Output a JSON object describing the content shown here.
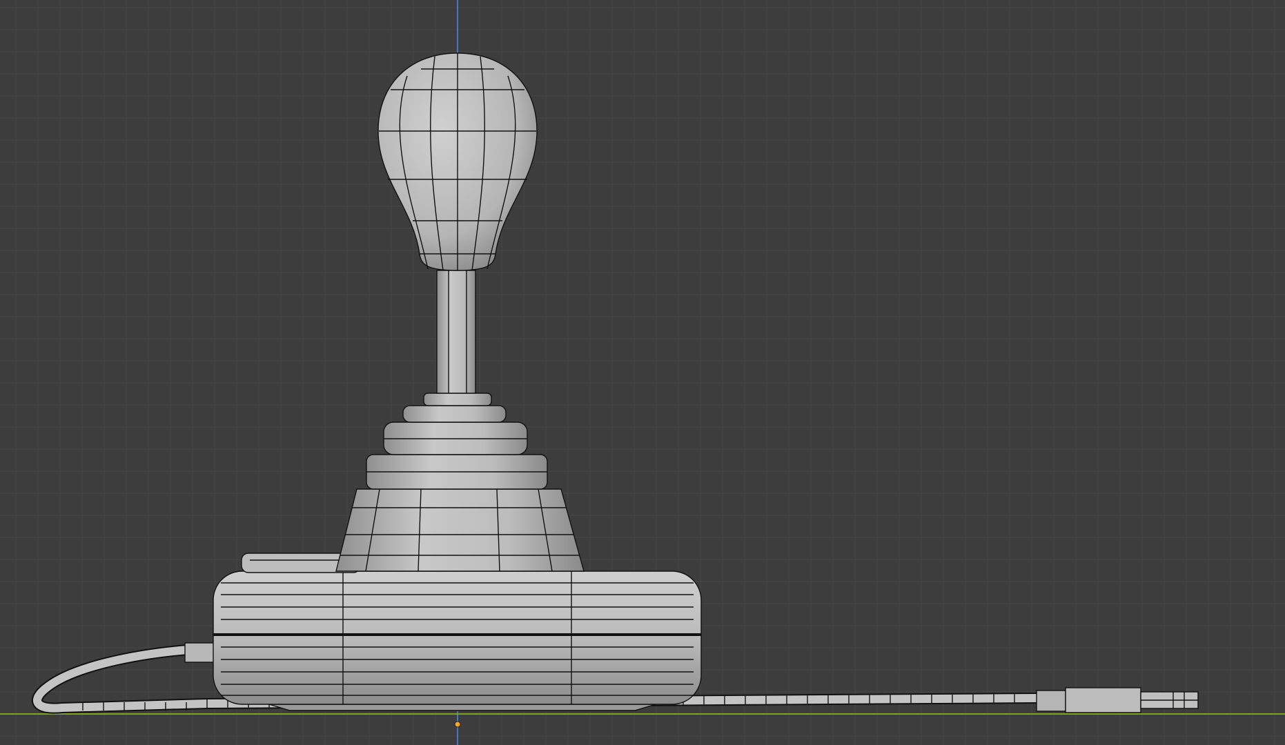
{
  "viewport": {
    "mode": "wireframe-over-solid",
    "colors": {
      "background": "#3d3d3d",
      "grid_minor": "#474747",
      "grid_major": "#4f4f4f",
      "axis_z": "#4a8fe0",
      "axis_y": "#7fa12e",
      "origin": "#f5a623",
      "mesh_fill": "#bdbdbd",
      "mesh_wire": "#111111"
    }
  }
}
